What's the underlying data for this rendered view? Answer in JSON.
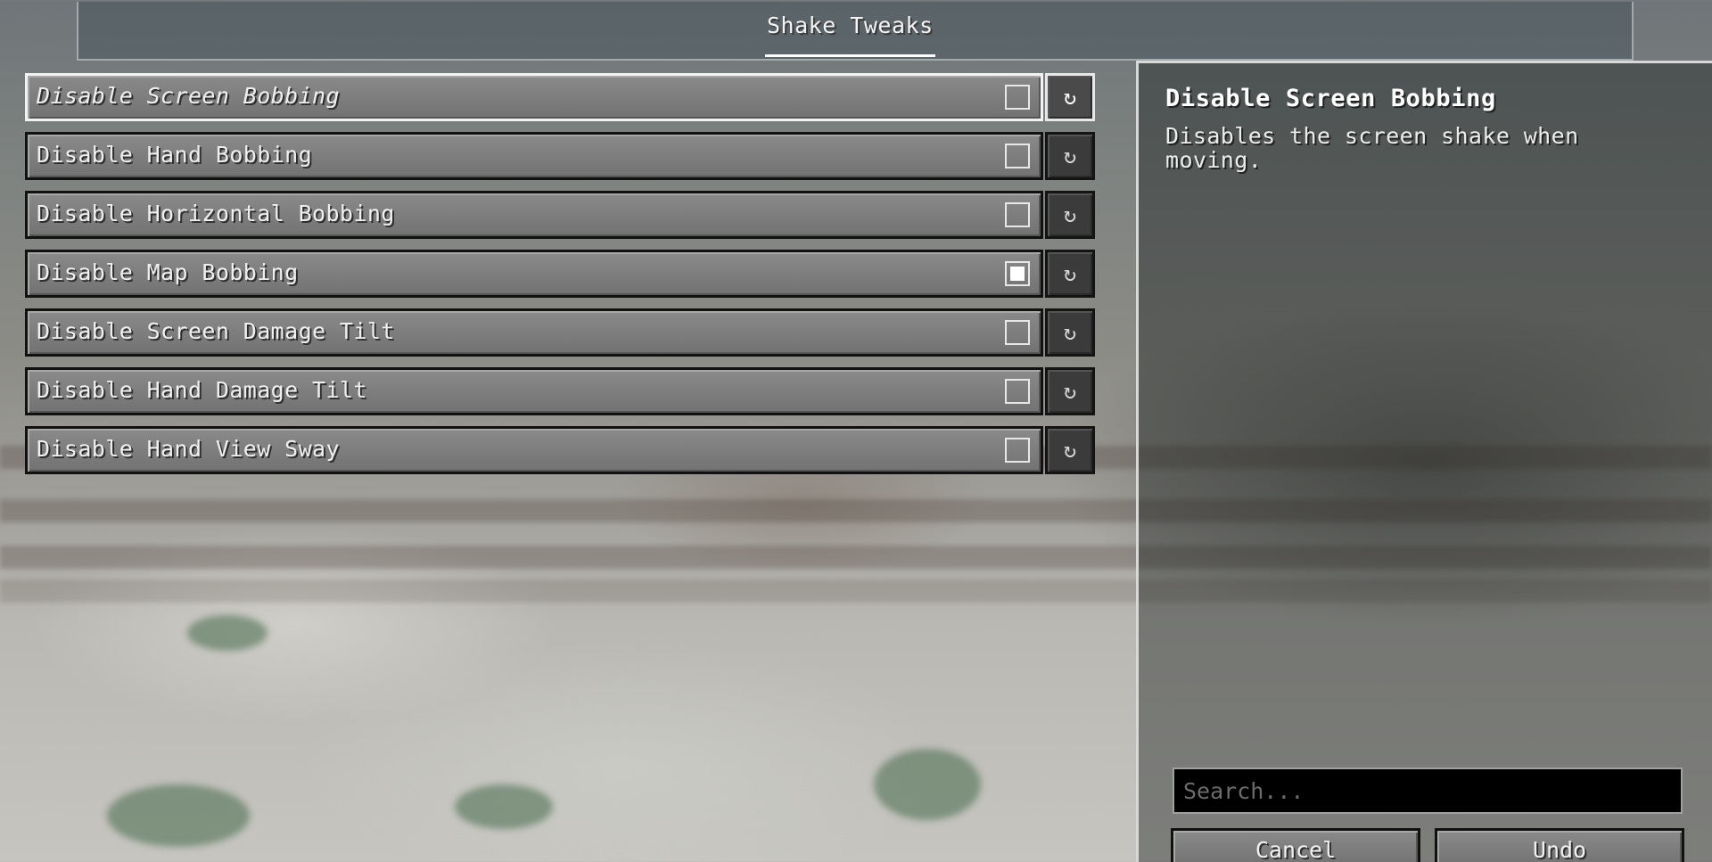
{
  "window": {
    "title": "Shake Tweaks"
  },
  "options": [
    {
      "label": "Disable Screen Bobbing",
      "checked": false,
      "selected": true
    },
    {
      "label": "Disable Hand Bobbing",
      "checked": false,
      "selected": false
    },
    {
      "label": "Disable Horizontal Bobbing",
      "checked": false,
      "selected": false
    },
    {
      "label": "Disable Map Bobbing",
      "checked": true,
      "selected": false
    },
    {
      "label": "Disable Screen Damage Tilt",
      "checked": false,
      "selected": false
    },
    {
      "label": "Disable Hand Damage Tilt",
      "checked": false,
      "selected": false
    },
    {
      "label": "Disable Hand View Sway",
      "checked": false,
      "selected": false
    }
  ],
  "reset_icon": "↻",
  "details": {
    "title": "Disable Screen Bobbing",
    "description": "Disables the screen shake when moving."
  },
  "search": {
    "placeholder": "Search...",
    "value": ""
  },
  "buttons": {
    "cancel": "Cancel",
    "undo": "Undo"
  }
}
